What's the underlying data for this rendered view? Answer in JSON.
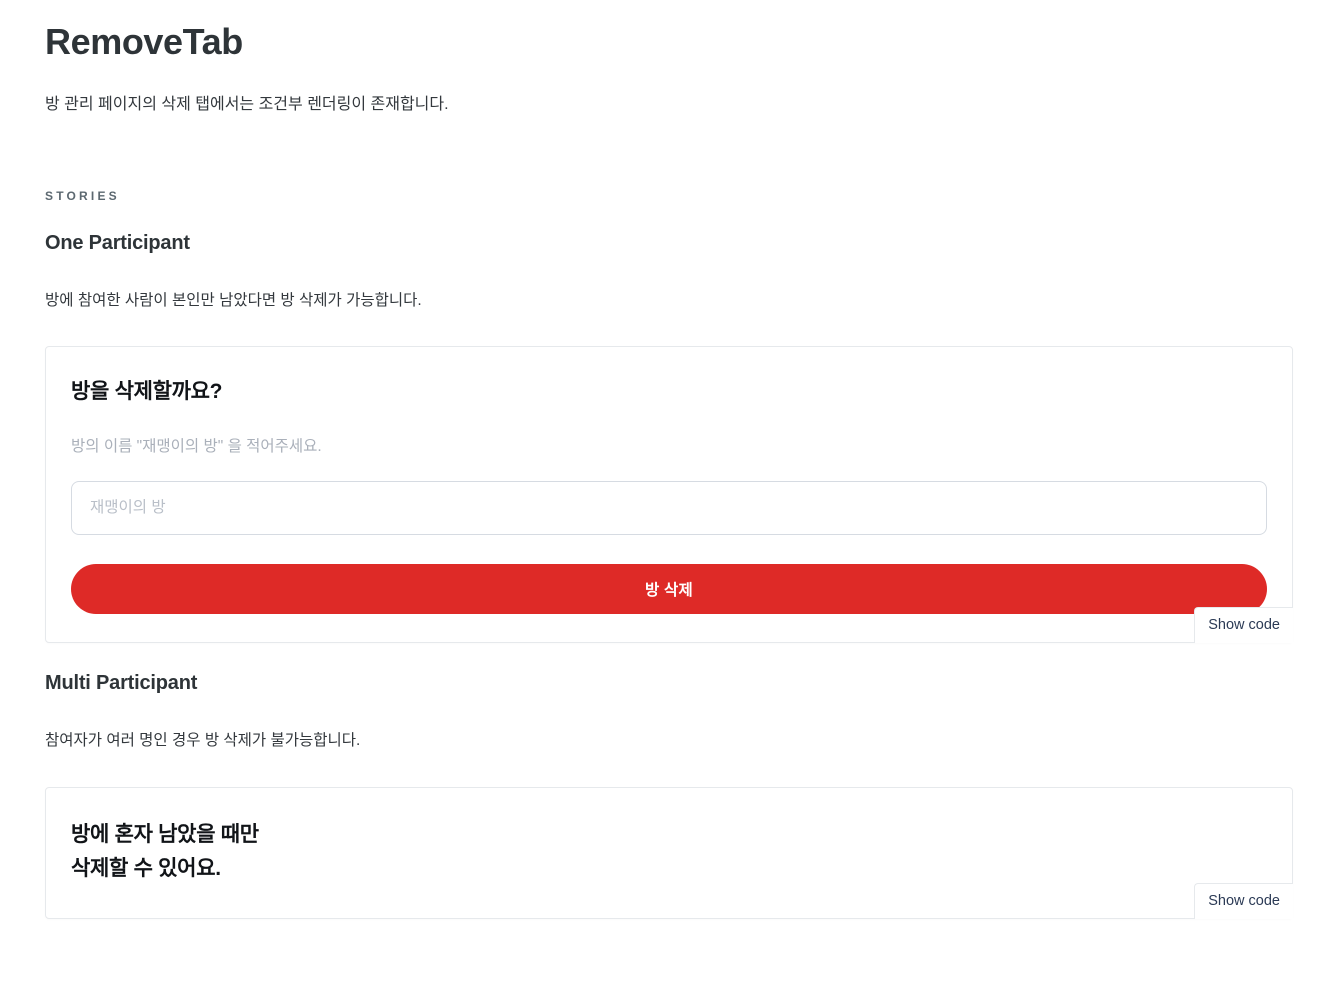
{
  "docs": {
    "title": "RemoveTab",
    "subtitle": "방 관리 페이지의 삭제 탭에서는 조건부 렌더링이 존재합니다.",
    "section_label": "STORIES",
    "show_code_label": "Show code"
  },
  "stories": [
    {
      "heading": "One Participant",
      "description": "방에 참여한 사람이 본인만 남았다면 방 삭제가 가능합니다.",
      "widget": {
        "title": "방을 삭제할까요?",
        "hint": "방의 이름 \"재맹이의 방\" 을 적어주세요.",
        "input_placeholder": "재맹이의 방",
        "input_value": "",
        "delete_button_label": "방 삭제"
      },
      "show_code_label": "Show code"
    },
    {
      "heading": "Multi Participant",
      "description": "참여자가 여러 명인 경우 방 삭제가 불가능합니다.",
      "widget": {
        "blocked_message": "방에 혼자 남았을 때만\n삭제할 수 있어요."
      },
      "show_code_label": "Show code"
    }
  ],
  "colors": {
    "danger": "#de2a27",
    "heading": "#2e3438",
    "label": "#5c6870",
    "muted": "#aab0ba",
    "border": "#e6e9ec",
    "input_border": "#d6dbe2"
  }
}
